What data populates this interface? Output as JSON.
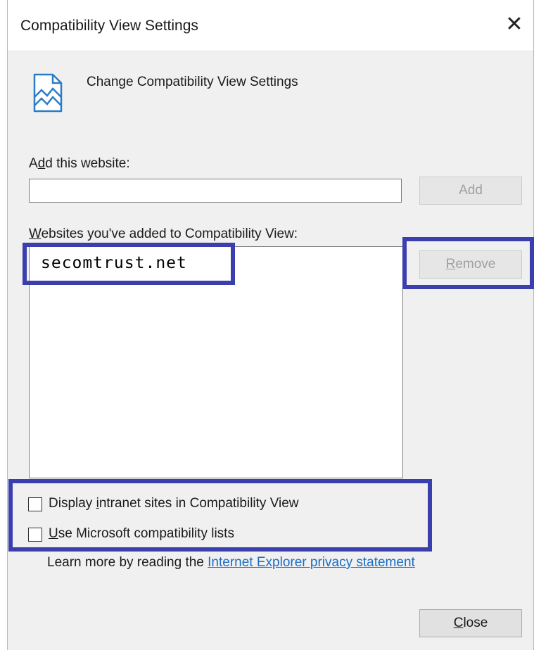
{
  "window": {
    "title": "Compatibility View Settings",
    "close_glyph": "✕"
  },
  "header": {
    "icon": "compatibility-view-icon",
    "text": "Change Compatibility View Settings"
  },
  "add_section": {
    "label_pre": "A",
    "label_mnemonic": "d",
    "label_post": "d this website:",
    "input_value": "",
    "add_button": "Add"
  },
  "list_section": {
    "label_pre": "",
    "label_mnemonic": "W",
    "label_post": "ebsites you've added to Compatibility View:",
    "items": [
      "secomtrust.net"
    ],
    "remove_button_mnemonic": "R",
    "remove_button_rest": "emove"
  },
  "options": [
    {
      "pre": "Display ",
      "mnemonic": "i",
      "post": "ntranet sites in Compatibility View",
      "checked": false
    },
    {
      "pre": "",
      "mnemonic": "U",
      "post": "se Microsoft compatibility lists",
      "checked": false
    }
  ],
  "footer": {
    "learn_more_text": "Learn more by reading the",
    "link_text": "Internet Explorer privacy statement",
    "close_mnemonic": "C",
    "close_rest": "lose"
  },
  "colors": {
    "highlight": "#3b3ead",
    "link": "#1a6dc4"
  }
}
